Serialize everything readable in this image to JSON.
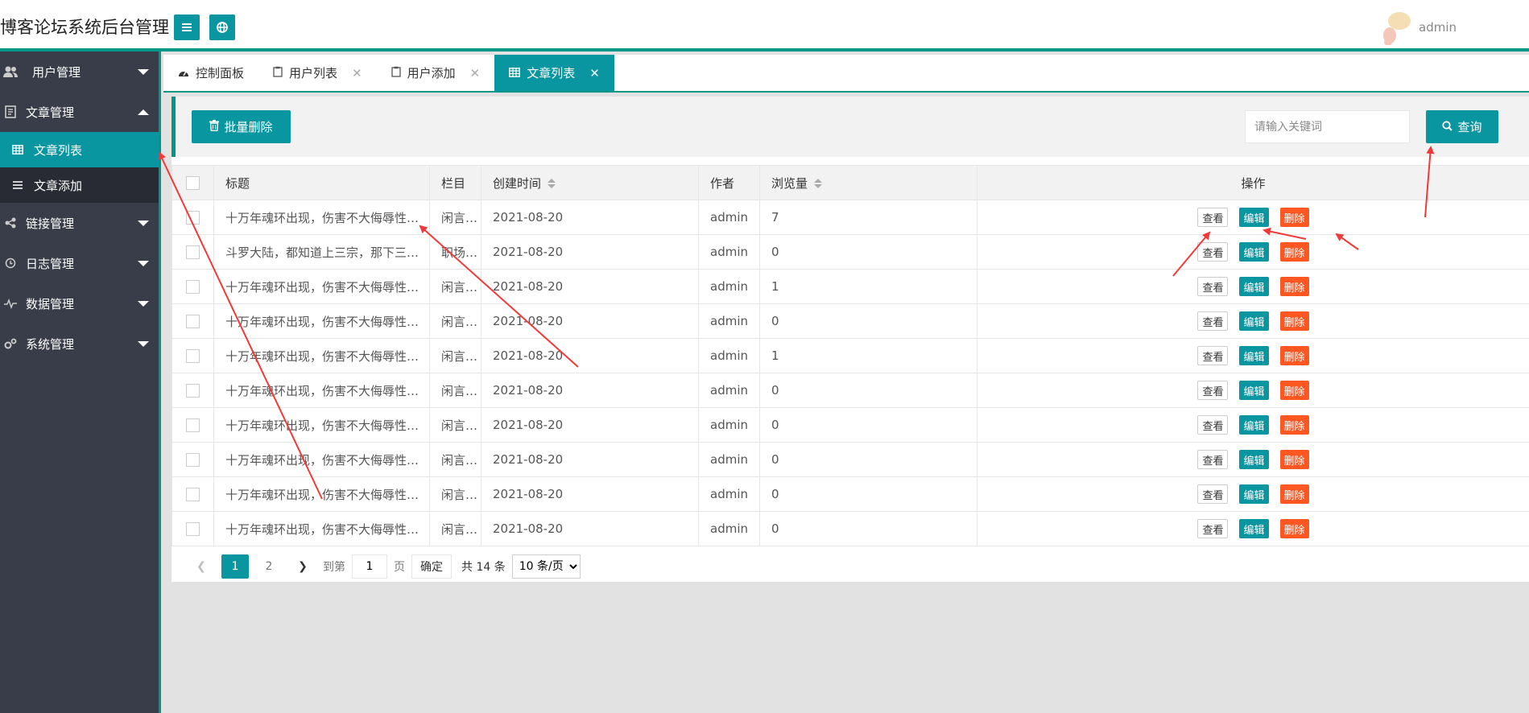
{
  "header": {
    "title": "博客论坛系统后台管理",
    "user": "admin"
  },
  "sidebar": {
    "items": [
      {
        "label": "用户管理",
        "icon": "users-icon"
      },
      {
        "label": "文章管理",
        "icon": "article-icon"
      },
      {
        "label": "链接管理",
        "icon": "share-icon"
      },
      {
        "label": "日志管理",
        "icon": "log-icon"
      },
      {
        "label": "数据管理",
        "icon": "pulse-icon"
      },
      {
        "label": "系统管理",
        "icon": "gears-icon"
      }
    ],
    "sub": [
      {
        "label": "文章列表",
        "icon": "table-icon"
      },
      {
        "label": "文章添加",
        "icon": "list-icon"
      }
    ]
  },
  "tabs": [
    {
      "label": "控制面板"
    },
    {
      "label": "用户列表"
    },
    {
      "label": "用户添加"
    },
    {
      "label": "文章列表"
    }
  ],
  "toolbar": {
    "batch_delete": "批量删除",
    "search_placeholder": "请输入关键词",
    "search_button": "查询"
  },
  "table": {
    "headers": {
      "title": "标题",
      "column": "栏目",
      "created": "创建时间",
      "author": "作者",
      "views": "浏览量",
      "actions": "操作"
    },
    "rows": [
      {
        "title": "十万年魂环出现，伤害不大侮辱性极强",
        "column": "闲言碎语",
        "date": "2021-08-20",
        "author": "admin",
        "views": "7"
      },
      {
        "title": "斗罗大陆，都知道上三宗，那下三宗是什么",
        "column": "职场文字",
        "date": "2021-08-20",
        "author": "admin",
        "views": "0"
      },
      {
        "title": "十万年魂环出现，伤害不大侮辱性极强",
        "column": "闲言碎语",
        "date": "2021-08-20",
        "author": "admin",
        "views": "1"
      },
      {
        "title": "十万年魂环出现，伤害不大侮辱性极强",
        "column": "闲言碎语",
        "date": "2021-08-20",
        "author": "admin",
        "views": "0"
      },
      {
        "title": "十万年魂环出现，伤害不大侮辱性极强",
        "column": "闲言碎语",
        "date": "2021-08-20",
        "author": "admin",
        "views": "1"
      },
      {
        "title": "十万年魂环出现，伤害不大侮辱性极强",
        "column": "闲言碎语",
        "date": "2021-08-20",
        "author": "admin",
        "views": "0"
      },
      {
        "title": "十万年魂环出现，伤害不大侮辱性极强",
        "column": "闲言碎语",
        "date": "2021-08-20",
        "author": "admin",
        "views": "0"
      },
      {
        "title": "十万年魂环出现，伤害不大侮辱性极强",
        "column": "闲言碎语",
        "date": "2021-08-20",
        "author": "admin",
        "views": "0"
      },
      {
        "title": "十万年魂环出现，伤害不大侮辱性极强",
        "column": "闲言碎语",
        "date": "2021-08-20",
        "author": "admin",
        "views": "0"
      },
      {
        "title": "十万年魂环出现，伤害不大侮辱性极强",
        "column": "闲言碎语",
        "date": "2021-08-20",
        "author": "admin",
        "views": "0"
      }
    ],
    "actions": {
      "view": "查看",
      "edit": "编辑",
      "delete": "删除"
    }
  },
  "pager": {
    "page1": "1",
    "page2": "2",
    "goto_label": "到第",
    "goto_value": "1",
    "page_unit": "页",
    "confirm": "确定",
    "total": "共 14 条",
    "page_size": "10 条/页"
  },
  "colors": {
    "accent": "#0a96a0",
    "danger": "#ff5722",
    "sidebar": "#393d49",
    "annotation": "#f03a3a"
  }
}
